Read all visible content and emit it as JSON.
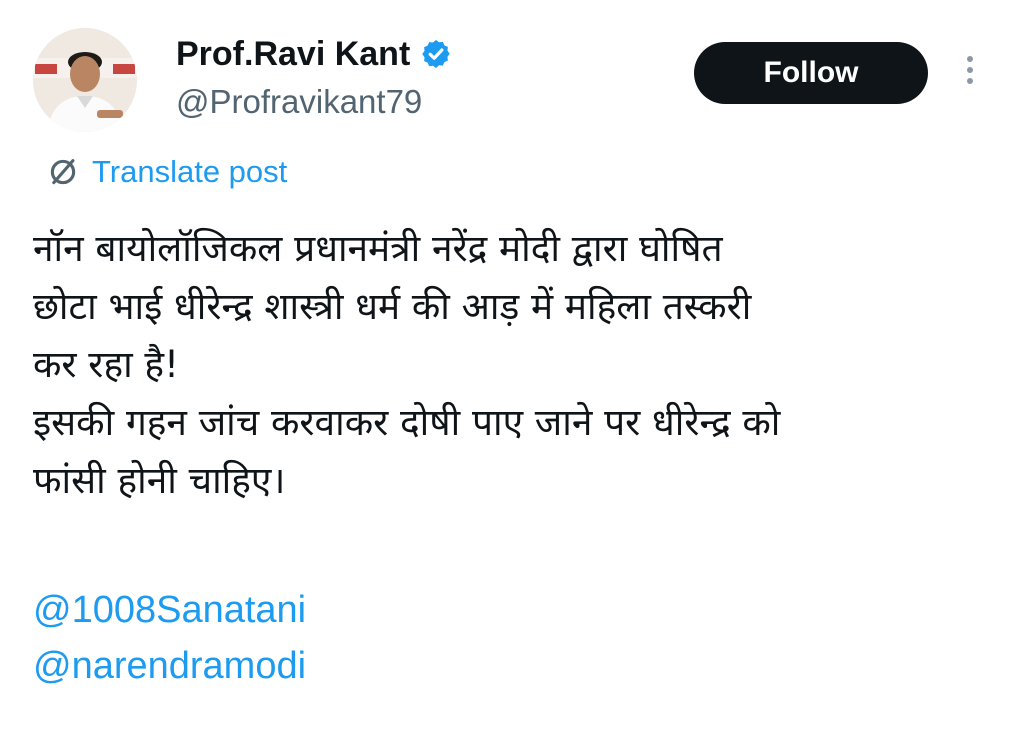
{
  "author": {
    "display_name": "Prof.Ravi Kant",
    "handle": "@Profravikant79",
    "verified": true,
    "avatar_icon": "profile-photo"
  },
  "actions": {
    "follow_label": "Follow",
    "more_icon": "more-vertical-icon"
  },
  "translate": {
    "label": "Translate post",
    "icon": "translate-icon"
  },
  "post": {
    "lines": [
      "नॉन बायोलॉजिकल प्रधानमंत्री नरेंद्र मोदी द्वारा घोषित",
      "छोटा भाई धीरेन्द्र शास्त्री धर्म की आड़ में महिला तस्करी",
      "कर रहा है!",
      "इसकी गहन जांच करवाकर दोषी पाए जाने पर धीरेन्द्र को",
      "फांसी होनी चाहिए।"
    ],
    "mentions": [
      "@1008Sanatani",
      "@narendramodi"
    ]
  },
  "colors": {
    "accent": "#1d9bf0",
    "text": "#0f1419",
    "secondary_text": "#536471",
    "button_bg": "#0f1419",
    "button_text": "#ffffff"
  }
}
